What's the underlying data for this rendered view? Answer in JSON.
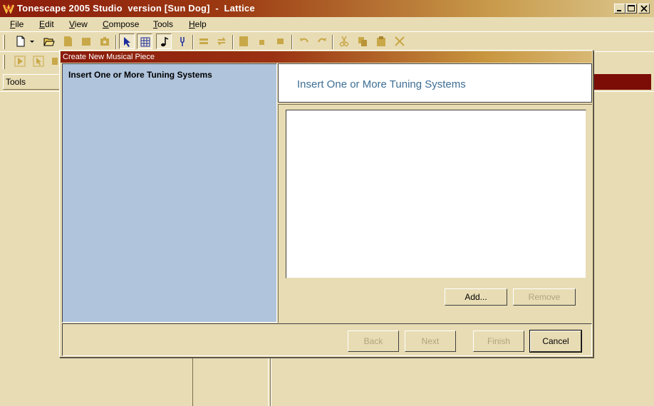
{
  "window": {
    "title": "Tonescape 2005 Studio  version [Sun Dog]  -  Lattice"
  },
  "menu": [
    {
      "key": "F",
      "rest": "ile"
    },
    {
      "key": "E",
      "rest": "dit"
    },
    {
      "key": "V",
      "rest": "iew"
    },
    {
      "key": "C",
      "rest": "ompose"
    },
    {
      "key": "T",
      "rest": "ools"
    },
    {
      "key": "H",
      "rest": "elp"
    }
  ],
  "panels": {
    "tools_label": "Tools"
  },
  "dialog": {
    "title": "Create New Musical Piece",
    "step_heading": "Insert One or More Tuning Systems",
    "header_title": "Insert One or More Tuning Systems",
    "add_label": "Add...",
    "remove_label": "Remove",
    "back_label": "Back",
    "next_label": "Next",
    "finish_label": "Finish",
    "cancel_label": "Cancel"
  },
  "colors": {
    "accent": "#3c6e94",
    "title_dark": "#8c1c0c",
    "pane_blue": "#b0c4dc",
    "face": "#e8dcb4"
  }
}
